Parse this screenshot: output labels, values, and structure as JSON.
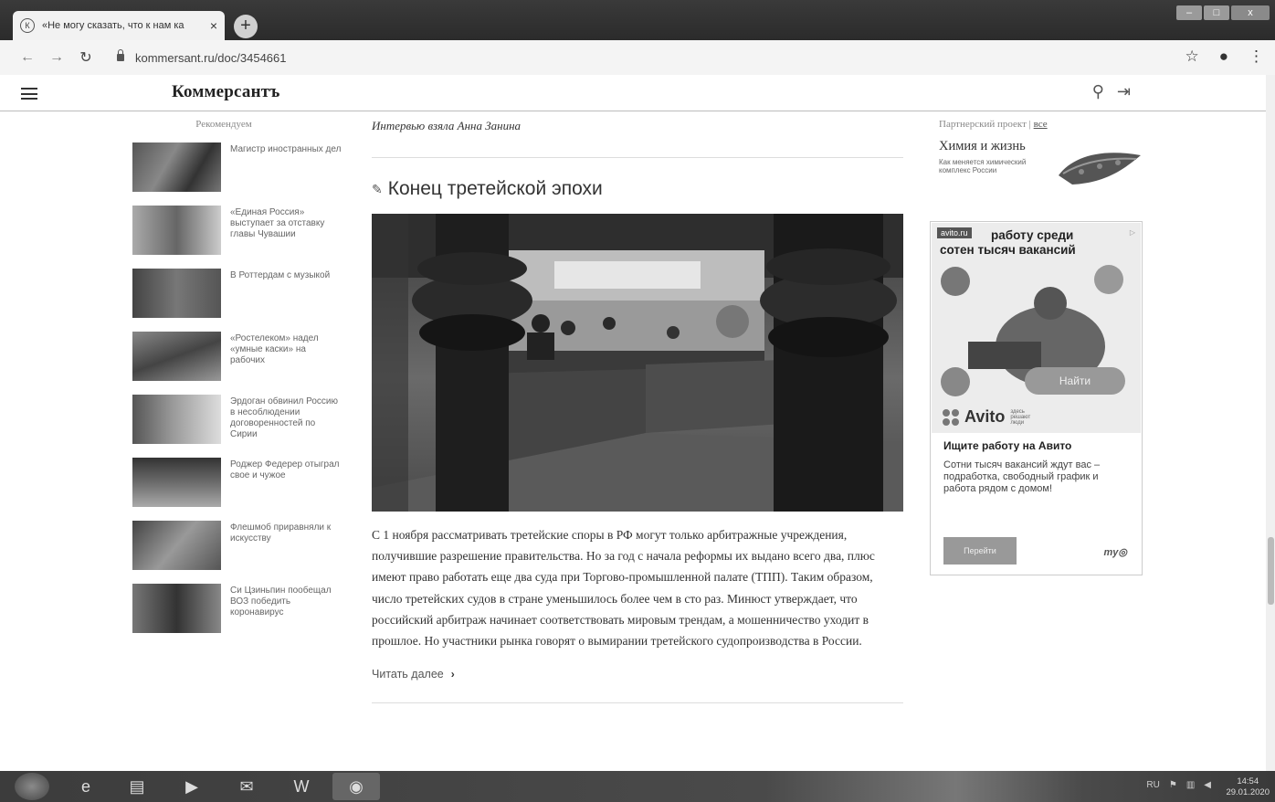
{
  "browser": {
    "tab_title": "«Не могу сказать, что к нам ка",
    "tab_close": "×",
    "new_tab": "+",
    "url": "kommersant.ru/doc/3454661",
    "window_controls": [
      "–",
      "□",
      "x"
    ]
  },
  "site": {
    "logo": "Коммерсантъ"
  },
  "left": {
    "title": "Рекомендуем",
    "items": [
      {
        "text": "Магистр иностранных дел"
      },
      {
        "text": "«Единая Россия» выступает за отставку главы Чувашии"
      },
      {
        "text": "В Роттердам с музыкой"
      },
      {
        "text": "«Ростелеком» надел «умные каски» на рабочих"
      },
      {
        "text": "Эрдоган обвинил Россию в несоблюдении договоренностей по Сирии"
      },
      {
        "text": "Роджер Федерер отыграл свое и чужое"
      },
      {
        "text": "Флешмоб приравняли к искусству"
      },
      {
        "text": "Си Цзиньпин пообещал ВОЗ победить коронавирус"
      }
    ]
  },
  "main": {
    "byline": "Интервью взяла Анна Занина",
    "title": "Конец третейской эпохи",
    "body": "С 1 ноября рассматривать третейские споры в РФ могут только арбитражные учреждения, получившие разрешение правительства. Но за год с начала реформы их выдано всего два, плюс имеют право работать еще два суда при Торгово-промышленной палате (ТПП). Таким образом, число третейских судов в стране уменьшилось более чем в сто раз. Минюст утверждает, что российский арбитраж начинает соответствовать мировым трендам, а мошенничество уходит в прошлое. Но участники рынка говорят о вымирании третейского судопроизводства в России.",
    "read_more": "Читать далее"
  },
  "right": {
    "partner_label": "Партнерский проект",
    "partner_sep": " | ",
    "partner_all": "все",
    "promo_title": "Химия и жизнь",
    "promo_sub": "Как меняется химический комплекс России",
    "ad": {
      "badge": "avito.ru",
      "headline_1": "работу среди",
      "headline_2": "сотен тысяч вакансий",
      "find_btn": "Найти",
      "brand": "Avito",
      "brand_tag": "здесь решают люди",
      "title": "Ищите работу на Авито",
      "text": "Сотни тысяч вакансий ждут вас – подработка, свободный график и работа рядом с домом!",
      "go_btn": "Перейти",
      "network": "my"
    }
  },
  "taskbar": {
    "lang": "RU",
    "time": "14:54",
    "date": "29.01.2020"
  }
}
